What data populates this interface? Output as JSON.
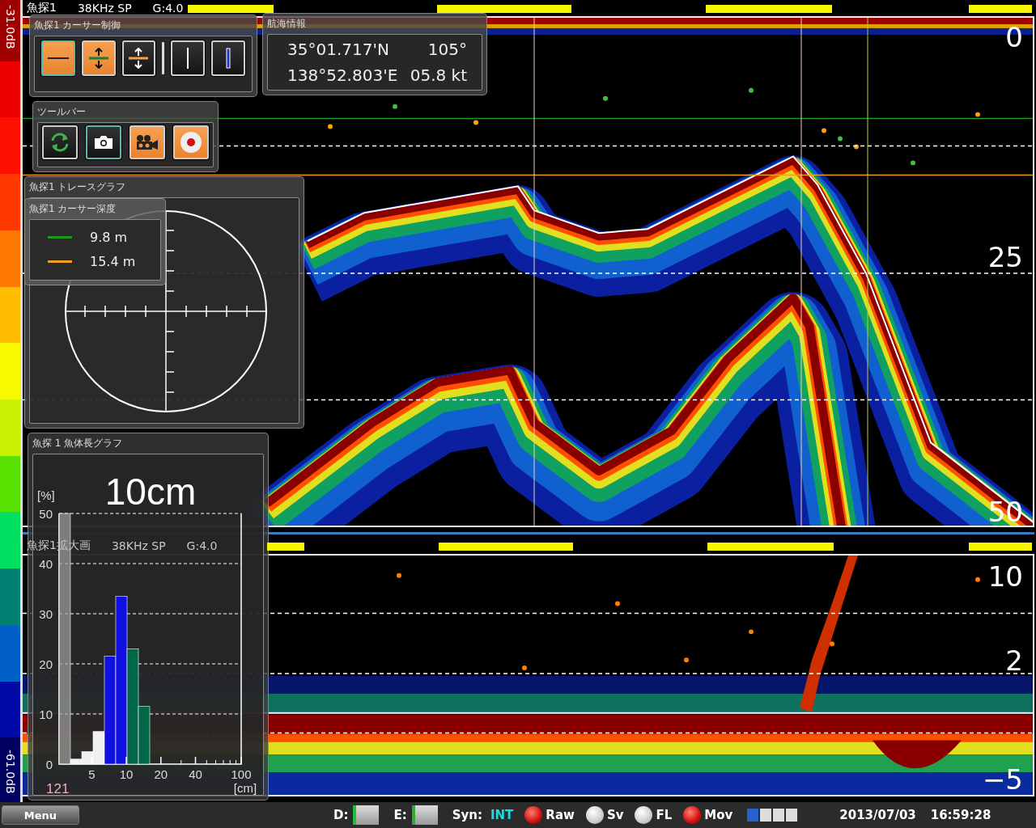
{
  "color_scale": {
    "top_label": "-31.0dB",
    "bottom_label": "-61.0dB"
  },
  "echogram": {
    "source": "魚探1",
    "frequency": "38KHz SP",
    "gain": "G:4.0",
    "depth_labels": [
      "0",
      "25",
      "50"
    ]
  },
  "zoom_echogram": {
    "source": "魚探1拡大画",
    "frequency": "38KHz SP",
    "gain": "G:4.0",
    "depth_labels": [
      "10",
      "2",
      "−5"
    ]
  },
  "cursor_control": {
    "title": "魚探1 カーサー制御",
    "buttons": [
      {
        "kind": "line",
        "on": true,
        "selected": true
      },
      {
        "kind": "range_green",
        "on": true,
        "selected": false
      },
      {
        "kind": "range_orange",
        "on": false,
        "selected": false
      },
      {
        "kind": "divider"
      },
      {
        "kind": "vertical_white",
        "on": false,
        "selected": false
      },
      {
        "kind": "vertical_blue",
        "on": false,
        "selected": false
      }
    ]
  },
  "navigation": {
    "title": "航海情報",
    "latitude": "35°01.717'N",
    "heading": "105°",
    "longitude": "138°52.803'E",
    "speed": "05.8 kt"
  },
  "toolbar": {
    "title": "ツールバー",
    "buttons": [
      {
        "kind": "refresh",
        "on": false,
        "selected": false
      },
      {
        "kind": "camera",
        "on": false,
        "selected": true
      },
      {
        "kind": "video",
        "on": true,
        "selected": false
      },
      {
        "kind": "record",
        "on": true,
        "selected": false
      }
    ]
  },
  "trace_graph": {
    "title": "魚探1 トレースグラフ"
  },
  "cursor_depth": {
    "title": "魚探1 カーサー深度",
    "cursors": [
      {
        "color": "#1a9a1a",
        "depth": "9.8 m"
      },
      {
        "color": "#f0a020",
        "depth": "15.4 m"
      }
    ]
  },
  "fish_length": {
    "title": "魚探 1 魚体長グラフ",
    "size": "10cm",
    "count": "121",
    "x_tick_labels": [
      "5",
      "10",
      "20",
      "40",
      "100"
    ],
    "chart_data": {
      "type": "bar",
      "ylabel": "[%]",
      "grid": true,
      "annotations": [
        {
          "text": "[cm]"
        }
      ],
      "values": [
        50,
        1,
        2.5,
        6.5,
        21.5,
        33.5,
        23,
        11.5
      ],
      "colors": [
        "#9a9a9a",
        "#f0f0f0",
        "#f0f0f0",
        "#f0f0f0",
        "#1010e0",
        "#1010e0",
        "#006848",
        "#006848"
      ],
      "ylim": [
        0,
        50
      ],
      "yticks": [
        0,
        10,
        20,
        30,
        40,
        50
      ]
    }
  },
  "status_bar": {
    "menu": "Menu",
    "d_label": "D:",
    "e_label": "E:",
    "sync_label": "Syn:",
    "sync_value": "INT",
    "lamps": [
      {
        "label": "Raw",
        "on": true
      },
      {
        "label": "Sv",
        "on": false
      },
      {
        "label": "FL",
        "on": false
      },
      {
        "label": "Mov",
        "on": true
      }
    ],
    "progress": {
      "level": 0.25
    },
    "date": "2013/07/03",
    "time": "16:59:28"
  }
}
